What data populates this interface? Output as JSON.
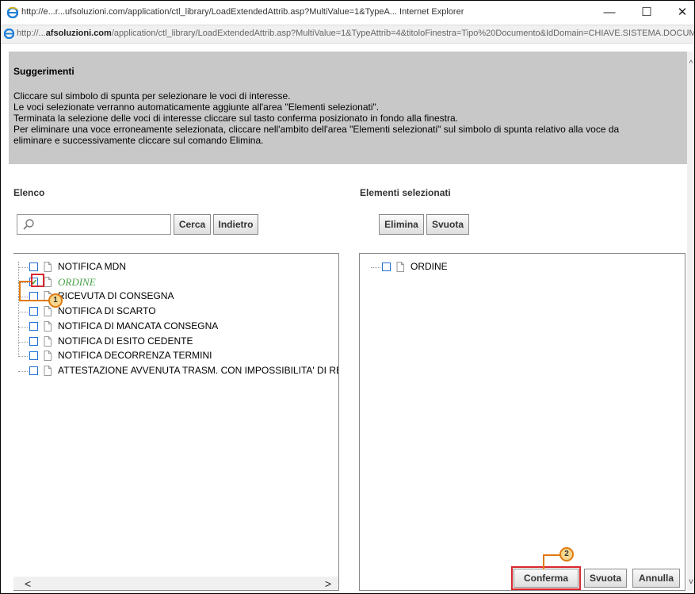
{
  "window": {
    "title": "http://e...r...ufsoluzioni.com/application/ctl_library/LoadExtendedAttrib.asp?MultiValue=1&TypeA...  Internet Explorer",
    "minimize": "—",
    "maximize": "☐",
    "close": "✕"
  },
  "address": {
    "prefix": "http://...",
    "domain": "afsoluzioni.com",
    "rest": "/application/ctl_library/LoadExtendedAttrib.asp?MultiValue=1&TypeAttrib=4&titoloFinestra=Tipo%20Documento&IdDomain=CHIAVE.SISTEMA.DOCUMENT"
  },
  "help": {
    "title": "Suggerimenti",
    "lines": [
      "Cliccare sul simbolo di spunta per selezionare le voci di interesse.",
      "Le voci selezionate verranno automaticamente aggiunte all'area \"Elementi selezionati\".",
      "Terminata la selezione delle voci di interesse cliccare sul tasto conferma posizionato in fondo alla finestra.",
      "Per eliminare una voce erroneamente selezionata, cliccare nell'ambito dell'area \"Elementi selezionati\" sul simbolo di spunta relativo alla voce da",
      "eliminare e successivamente cliccare sul comando Elimina."
    ]
  },
  "left": {
    "label": "Elenco",
    "search": {
      "value": "",
      "placeholder": ""
    },
    "buttons": {
      "search": "Cerca",
      "back": "Indietro"
    },
    "items": [
      {
        "label": "NOTIFICA MDN",
        "checked": false
      },
      {
        "label": "ORDINE",
        "checked": true
      },
      {
        "label": "RICEVUTA DI CONSEGNA",
        "checked": false
      },
      {
        "label": "NOTIFICA DI SCARTO",
        "checked": false
      },
      {
        "label": "NOTIFICA DI MANCATA CONSEGNA",
        "checked": false
      },
      {
        "label": "NOTIFICA DI ESITO CEDENTE",
        "checked": false
      },
      {
        "label": "NOTIFICA DECORRENZA TERMINI",
        "checked": false
      },
      {
        "label": "ATTESTAZIONE AVVENUTA TRASM. CON IMPOSSIBILITA' DI RECAPITO",
        "checked": false
      }
    ]
  },
  "right": {
    "label": "Elementi selezionati",
    "buttons": {
      "delete": "Elimina",
      "clear": "Svuota"
    },
    "items": [
      {
        "label": "ORDINE",
        "checked": false
      }
    ]
  },
  "footer": {
    "confirm": "Conferma",
    "clear": "Svuota",
    "cancel": "Annulla"
  },
  "callouts": {
    "one": "1",
    "two": "2"
  },
  "colors": {
    "help_bg": "#c8c8c8",
    "selected_text": "#4aa04a",
    "callout_border": "#e07a10",
    "callout_fill": "#f5d78e",
    "highlight": "#d9262e"
  }
}
